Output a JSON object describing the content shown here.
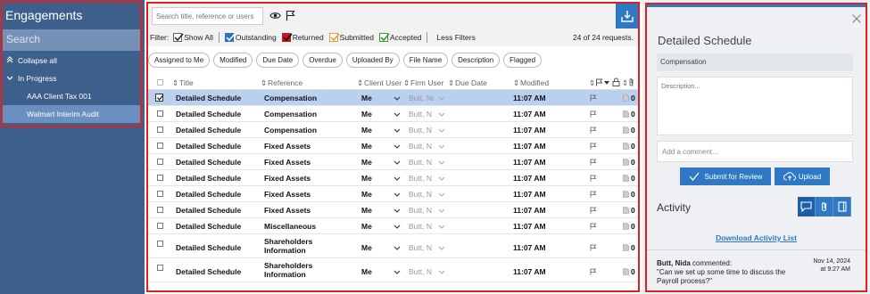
{
  "sidebar": {
    "title": "Engagements",
    "search_placeholder": "Search",
    "collapse_label": "Collapse all",
    "group_label": "In Progress",
    "items": [
      {
        "label": "AAA Client Tax 001",
        "selected": false
      },
      {
        "label": "Walmart Interim Audit",
        "selected": true
      }
    ]
  },
  "toolbar": {
    "search_placeholder": "Search title, reference or users"
  },
  "filters": {
    "label": "Filter:",
    "show_all": "Show All",
    "outstanding": "Outstanding",
    "returned": "Returned",
    "submitted": "Submitted",
    "accepted": "Accepted",
    "less_filters": "Less Filters",
    "count": "24 of 24 requests.",
    "colors": {
      "outstanding": "#2f6fbf",
      "returned": "#c0191f",
      "submitted": "#e8a13a",
      "accepted": "#3a9a3a"
    }
  },
  "chips": [
    "Assigned to Me",
    "Modified",
    "Due Date",
    "Overdue",
    "Uploaded By",
    "File Name",
    "Description",
    "Flagged"
  ],
  "grid": {
    "headers": {
      "title": "Title",
      "reference": "Reference",
      "client_user": "Client User",
      "firm_user": "Firm User",
      "due_date": "Due Date",
      "modified": "Modified"
    },
    "rows": [
      {
        "title": "Detailed Schedule",
        "reference": "Compensation",
        "client_user": "Me",
        "firm_user": "Butt, Ni",
        "modified": "11:07 AM",
        "count": "0",
        "selected": true
      },
      {
        "title": "Detailed Schedule",
        "reference": "Compensation",
        "client_user": "Me",
        "firm_user": "Butt, N",
        "modified": "11:07 AM",
        "count": "0"
      },
      {
        "title": "Detailed Schedule",
        "reference": "Compensation",
        "client_user": "Me",
        "firm_user": "Butt, N",
        "modified": "11:07 AM",
        "count": "0"
      },
      {
        "title": "Detailed Schedule",
        "reference": "Fixed Assets",
        "client_user": "Me",
        "firm_user": "Butt, N",
        "modified": "11:07 AM",
        "count": "0"
      },
      {
        "title": "Detailed Schedule",
        "reference": "Fixed Assets",
        "client_user": "Me",
        "firm_user": "Butt, N",
        "modified": "11:07 AM",
        "count": "0"
      },
      {
        "title": "Detailed Schedule",
        "reference": "Fixed Assets",
        "client_user": "Me",
        "firm_user": "Butt, N",
        "modified": "11:07 AM",
        "count": "0"
      },
      {
        "title": "Detailed Schedule",
        "reference": "Fixed Assets",
        "client_user": "Me",
        "firm_user": "Butt, N",
        "modified": "11:07 AM",
        "count": "0"
      },
      {
        "title": "Detailed Schedule",
        "reference": "Fixed Assets",
        "client_user": "Me",
        "firm_user": "Butt, N",
        "modified": "11:07 AM",
        "count": "0"
      },
      {
        "title": "Detailed Schedule",
        "reference": "Miscellaneous",
        "client_user": "Me",
        "firm_user": "Butt, N",
        "modified": "11:07 AM",
        "count": "0"
      },
      {
        "title": "Detailed Schedule",
        "reference": "Shareholders Information",
        "client_user": "Me",
        "firm_user": "Butt, N",
        "modified": "11:07 AM",
        "count": "0"
      },
      {
        "title": "Detailed Schedule",
        "reference": "Shareholders Information",
        "client_user": "Me",
        "firm_user": "Butt, N",
        "modified": "11:07 AM",
        "count": "0"
      }
    ]
  },
  "detail": {
    "title": "Detailed Schedule",
    "reference": "Compensation",
    "description_placeholder": "Description...",
    "comment_placeholder": "Add a comment...",
    "submit_label": "Submit for Review",
    "upload_label": "Upload",
    "activity_label": "Activity",
    "download_list_label": "Download Activity List",
    "comment": {
      "author": "Butt, Nida",
      "verb": "commented:",
      "text": "\"Can we set up some time to discuss the Payroll process?\"",
      "date": "Nov 14, 2024",
      "time": "at 9:27 AM"
    }
  },
  "colors": {
    "sidebar_bg": "#3d5f8c",
    "accent": "#2f78c4",
    "selected_row": "#b9d1ef"
  }
}
